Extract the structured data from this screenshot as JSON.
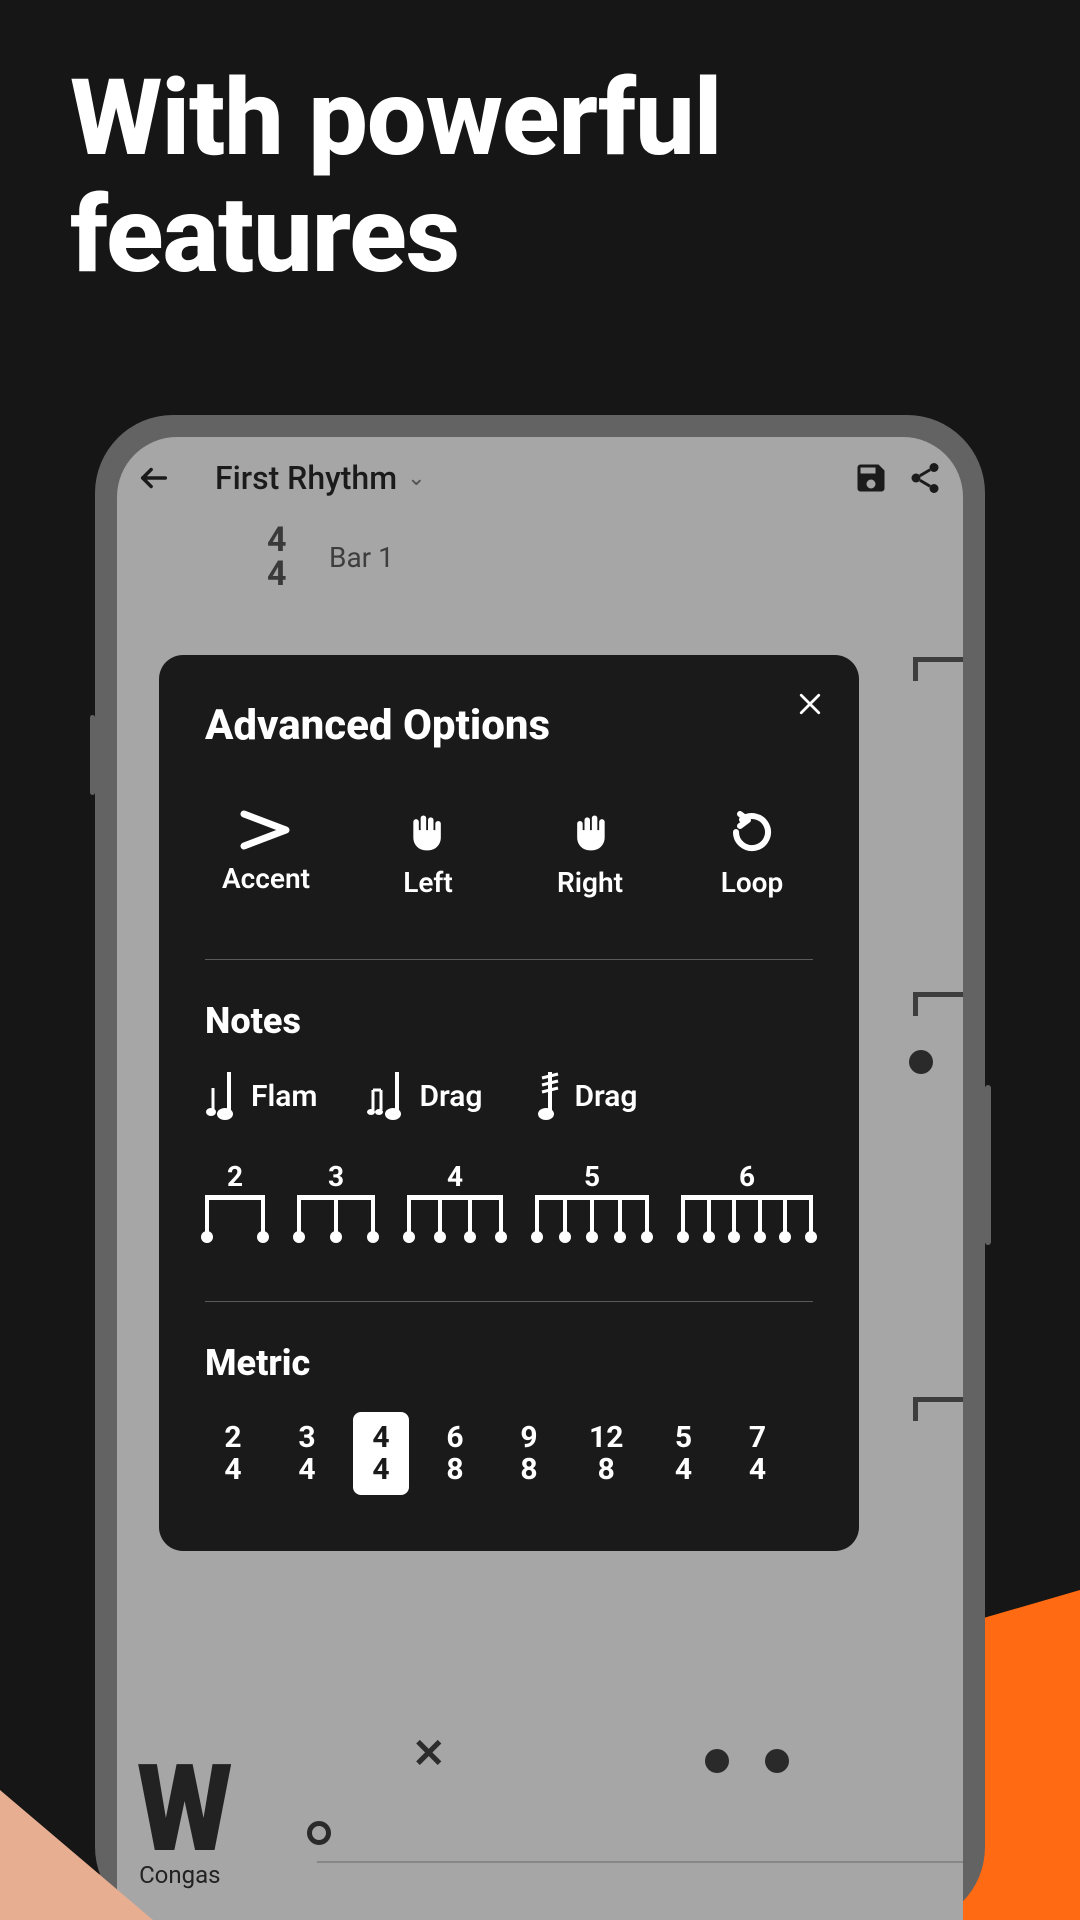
{
  "headline": {
    "line1": "With powerful",
    "line2": "features"
  },
  "topbar": {
    "title": "First Rhythm"
  },
  "timesig": {
    "top": "4",
    "bottom": "4"
  },
  "bar_label": "Bar 1",
  "instrument": {
    "glyph": "W",
    "label": "Congas"
  },
  "panel": {
    "title": "Advanced Options",
    "options": {
      "accent": "Accent",
      "left": "Left",
      "right": "Right",
      "loop": "Loop"
    },
    "notes_label": "Notes",
    "note_types": {
      "flam": "Flam",
      "drag1": "Drag",
      "drag2": "Drag"
    },
    "tuplets": [
      "2",
      "3",
      "4",
      "5",
      "6"
    ],
    "metric_label": "Metric",
    "metrics": [
      {
        "top": "2",
        "bottom": "4",
        "selected": false
      },
      {
        "top": "3",
        "bottom": "4",
        "selected": false
      },
      {
        "top": "4",
        "bottom": "4",
        "selected": true
      },
      {
        "top": "6",
        "bottom": "8",
        "selected": false
      },
      {
        "top": "9",
        "bottom": "8",
        "selected": false
      },
      {
        "top": "12",
        "bottom": "8",
        "selected": false
      },
      {
        "top": "5",
        "bottom": "4",
        "selected": false
      },
      {
        "top": "7",
        "bottom": "4",
        "selected": false
      }
    ]
  }
}
